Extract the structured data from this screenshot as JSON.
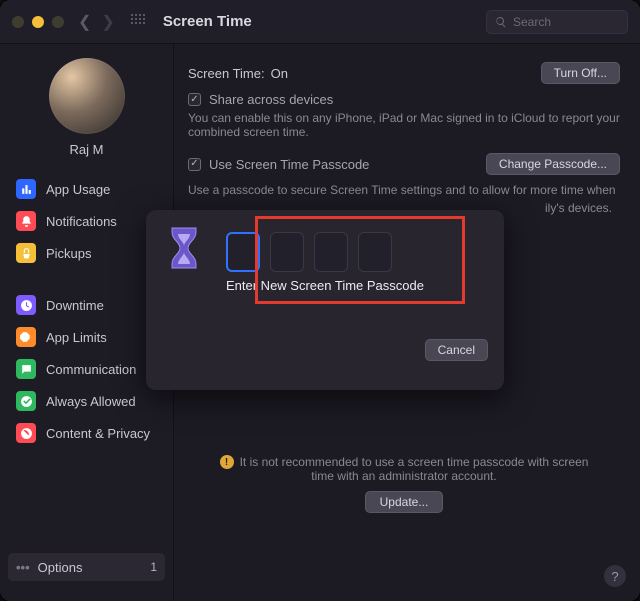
{
  "titlebar": {
    "title": "Screen Time",
    "search_placeholder": "Search"
  },
  "sidebar": {
    "username": "Raj M",
    "items1": [
      {
        "label": "App Usage"
      },
      {
        "label": "Notifications"
      },
      {
        "label": "Pickups"
      }
    ],
    "items2": [
      {
        "label": "Downtime"
      },
      {
        "label": "App Limits"
      },
      {
        "label": "Communication"
      },
      {
        "label": "Always Allowed"
      },
      {
        "label": "Content & Privacy"
      }
    ],
    "options_label": "Options",
    "options_badge": "1"
  },
  "main": {
    "screen_time_label": "Screen Time:",
    "screen_time_status": "On",
    "turn_off_label": "Turn Off...",
    "share_label": "Share across devices",
    "share_desc": "You can enable this on any iPhone, iPad or Mac signed in to iCloud to report your combined screen time.",
    "passcode_label": "Use Screen Time Passcode",
    "change_passcode_label": "Change Passcode...",
    "passcode_desc": "Use a passcode to secure Screen Time settings and to allow for more time when",
    "family_tail": "ily's devices.",
    "warning1": "It is not recommended to use a screen time passcode with screen",
    "warning2": "time with an administrator account.",
    "update_label": "Update..."
  },
  "dialog": {
    "prompt": "Enter New Screen Time Passcode",
    "cancel_label": "Cancel"
  }
}
